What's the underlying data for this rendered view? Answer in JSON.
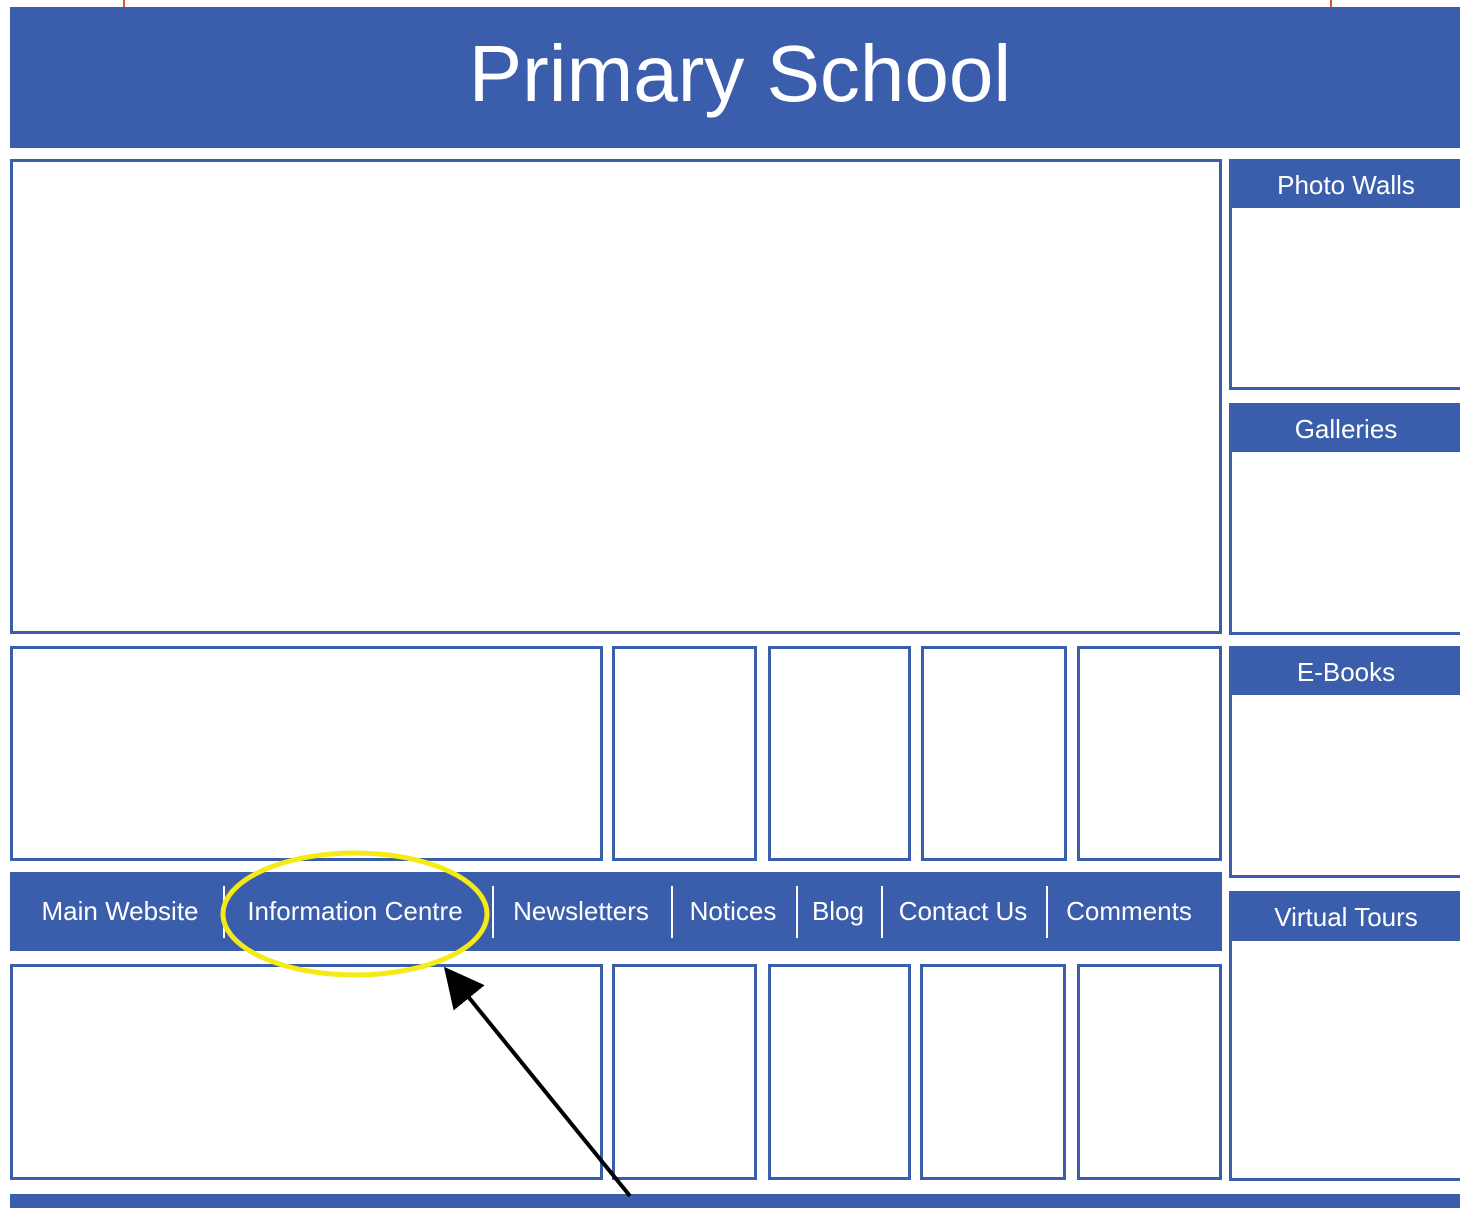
{
  "header": {
    "title": "Primary School"
  },
  "sidebar": {
    "panels": [
      {
        "label": "Photo Walls"
      },
      {
        "label": "Galleries"
      },
      {
        "label": "E-Books"
      },
      {
        "label": "Virtual Tours"
      }
    ]
  },
  "nav": {
    "items": [
      {
        "label": "Main Website"
      },
      {
        "label": "Information Centre"
      },
      {
        "label": "Newsletters"
      },
      {
        "label": "Notices"
      },
      {
        "label": "Blog"
      },
      {
        "label": "Contact Us"
      },
      {
        "label": "Comments"
      }
    ]
  },
  "annotation": {
    "highlighted_item": "Information Centre",
    "highlight_color": "#f5ea14",
    "arrow_color": "#000000"
  },
  "colors": {
    "brand_blue": "#3a5eab",
    "top_border_red": "#e8502f"
  }
}
